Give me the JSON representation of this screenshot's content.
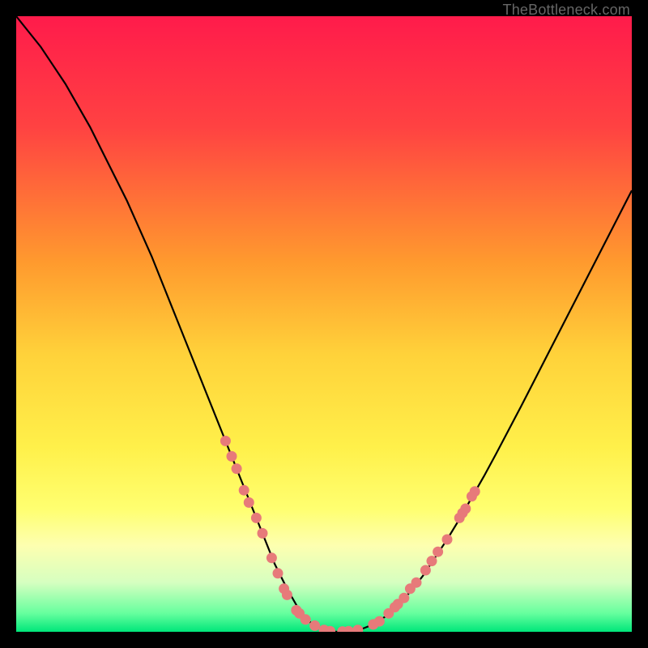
{
  "watermark": "TheBottleneck.com",
  "chart_data": {
    "type": "line",
    "title": "",
    "xlabel": "",
    "ylabel": "",
    "xlim": [
      0,
      100
    ],
    "ylim": [
      0,
      100
    ],
    "gradient_stops": [
      {
        "offset": 0,
        "color": "#ff1b4b"
      },
      {
        "offset": 18,
        "color": "#ff4242"
      },
      {
        "offset": 40,
        "color": "#ff9a2e"
      },
      {
        "offset": 55,
        "color": "#ffd23a"
      },
      {
        "offset": 70,
        "color": "#fff04a"
      },
      {
        "offset": 80,
        "color": "#ffff70"
      },
      {
        "offset": 86,
        "color": "#fdffb0"
      },
      {
        "offset": 92,
        "color": "#d6ffc0"
      },
      {
        "offset": 97,
        "color": "#66ff9e"
      },
      {
        "offset": 100,
        "color": "#00e67a"
      }
    ],
    "series": [
      {
        "name": "bottleneck-curve",
        "x": [
          0,
          2,
          4,
          6,
          8,
          10,
          12,
          14,
          16,
          18,
          20,
          22,
          24,
          26,
          28,
          30,
          32,
          34,
          36,
          38,
          40,
          42,
          44,
          46,
          48,
          50,
          52,
          54,
          56,
          58,
          60,
          62,
          64,
          66,
          68,
          70,
          72,
          74,
          76,
          78,
          80,
          82,
          84,
          86,
          88,
          90,
          92,
          94,
          96,
          98,
          100
        ],
        "values": [
          100,
          97.5,
          95,
          92,
          89,
          85.5,
          82,
          78,
          74,
          70,
          65.5,
          61,
          56,
          51,
          46,
          41,
          36,
          31,
          26,
          21,
          16,
          11,
          7,
          3.5,
          1.3,
          0.3,
          0,
          0.1,
          0.4,
          1.2,
          2.5,
          4.3,
          6.5,
          9,
          12,
          15,
          18.3,
          21.8,
          25.3,
          29,
          32.8,
          36.6,
          40.5,
          44.4,
          48.3,
          52.2,
          56.1,
          60,
          63.9,
          67.8,
          71.7
        ]
      }
    ],
    "markers": {
      "name": "data-points",
      "color": "#e77a7a",
      "points": [
        {
          "x": 34.0,
          "y": 31.0
        },
        {
          "x": 35.0,
          "y": 28.5
        },
        {
          "x": 35.8,
          "y": 26.5
        },
        {
          "x": 37.0,
          "y": 23.0
        },
        {
          "x": 37.8,
          "y": 21.0
        },
        {
          "x": 39.0,
          "y": 18.5
        },
        {
          "x": 40.0,
          "y": 16.0
        },
        {
          "x": 41.5,
          "y": 12.0
        },
        {
          "x": 42.5,
          "y": 9.5
        },
        {
          "x": 43.5,
          "y": 7.0
        },
        {
          "x": 44.0,
          "y": 6.0
        },
        {
          "x": 45.5,
          "y": 3.5
        },
        {
          "x": 46.0,
          "y": 3.0
        },
        {
          "x": 47.0,
          "y": 2.0
        },
        {
          "x": 48.5,
          "y": 1.0
        },
        {
          "x": 50.0,
          "y": 0.3
        },
        {
          "x": 51.0,
          "y": 0.1
        },
        {
          "x": 53.0,
          "y": 0.05
        },
        {
          "x": 54.0,
          "y": 0.1
        },
        {
          "x": 55.5,
          "y": 0.3
        },
        {
          "x": 58.0,
          "y": 1.2
        },
        {
          "x": 59.0,
          "y": 1.7
        },
        {
          "x": 60.5,
          "y": 3.0
        },
        {
          "x": 61.5,
          "y": 4.0
        },
        {
          "x": 62.0,
          "y": 4.5
        },
        {
          "x": 63.0,
          "y": 5.5
        },
        {
          "x": 64.0,
          "y": 7.0
        },
        {
          "x": 65.0,
          "y": 8.0
        },
        {
          "x": 66.5,
          "y": 10.0
        },
        {
          "x": 67.5,
          "y": 11.5
        },
        {
          "x": 68.5,
          "y": 13.0
        },
        {
          "x": 70.0,
          "y": 15.0
        },
        {
          "x": 72.0,
          "y": 18.5
        },
        {
          "x": 72.5,
          "y": 19.3
        },
        {
          "x": 73.0,
          "y": 20.0
        },
        {
          "x": 74.0,
          "y": 22.0
        },
        {
          "x": 74.5,
          "y": 22.8
        }
      ]
    }
  }
}
